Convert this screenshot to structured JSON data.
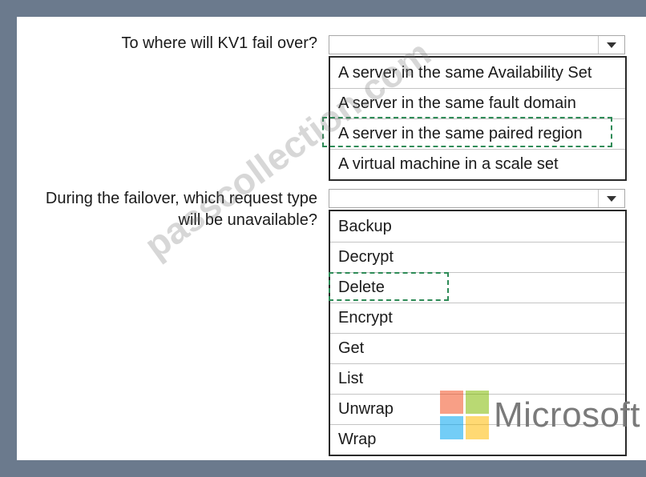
{
  "q1": {
    "question": "To where will KV1 fail over?",
    "options": [
      "A server in the same Availability Set",
      "A server in the same fault domain",
      "A server in the same paired region",
      "A virtual machine in a scale set"
    ],
    "selected_index": 2
  },
  "q2": {
    "question_line1": "During the failover, which request type",
    "question_line2": "will be  unavailable?",
    "options": [
      "Backup",
      "Decrypt",
      "Delete",
      "Encrypt",
      "Get",
      "List",
      "Unwrap",
      "Wrap"
    ],
    "selected_index": 2
  },
  "watermark": "passcollection.com",
  "brand": {
    "text": "Microsoft",
    "colors": [
      "#f25022",
      "#7fba00",
      "#00a4ef",
      "#ffb900"
    ]
  },
  "colors": {
    "frame": "#6b7a8d",
    "selection": "#2e8b57"
  }
}
